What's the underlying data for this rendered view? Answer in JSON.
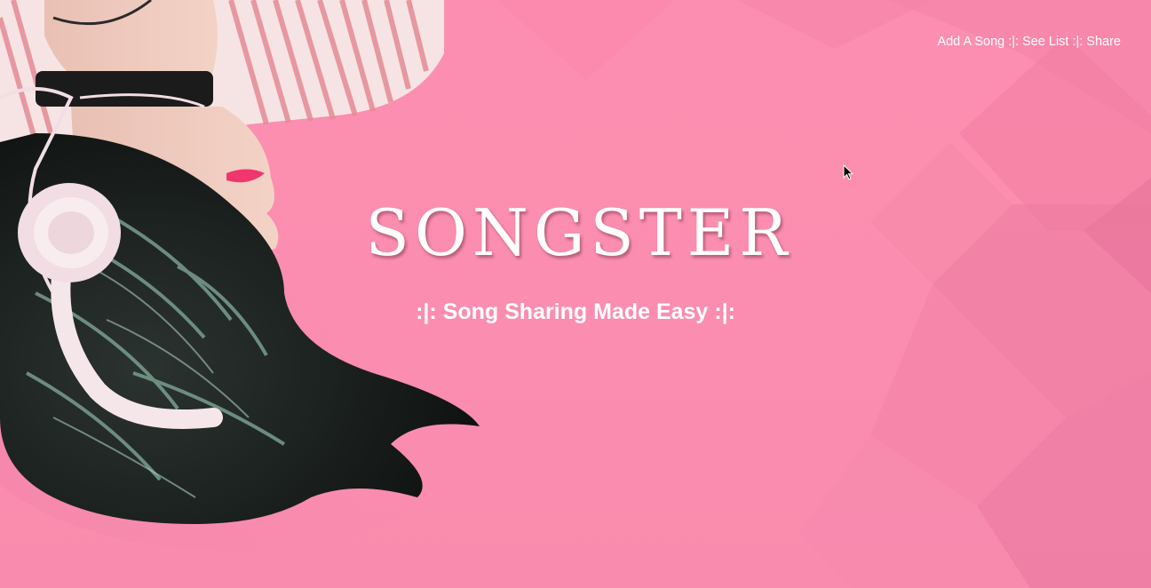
{
  "nav": {
    "items": [
      {
        "label": "Add A Song"
      },
      {
        "label": "See List"
      },
      {
        "label": "Share"
      }
    ],
    "separator": ":|:"
  },
  "hero": {
    "title": "SONGSTER",
    "tagline": ":|: Song Sharing Made Easy :|:"
  },
  "colors": {
    "background": "#fb8eb0",
    "facet_dark": "#ee7aa0",
    "text": "#ffffff"
  },
  "icons": {
    "cursor": "mouse-pointer-icon"
  }
}
